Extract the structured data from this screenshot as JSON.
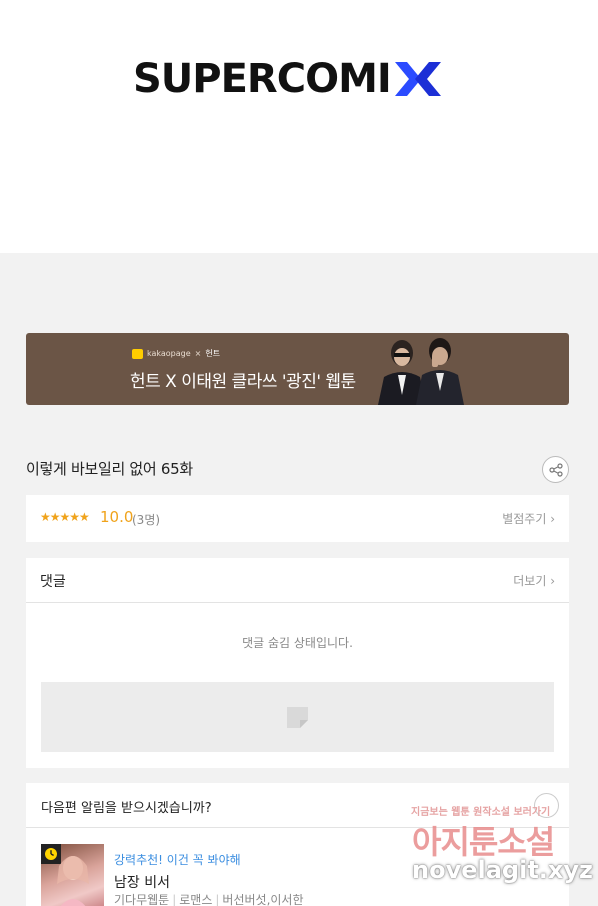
{
  "logo": {
    "text": "SUPERCOMI",
    "accent_color": "#2b4bff"
  },
  "banner": {
    "brand_left": "kakaopage",
    "brand_x": "×",
    "brand_right": "헌트",
    "text": "헌트 X 이태원 클라쓰 '광진' 웹툰",
    "bg_color": "#6b5546"
  },
  "episode": {
    "title": "이렇게 바보일리 없어 65화"
  },
  "rating": {
    "stars": "★★★★★",
    "value": "10.0",
    "count": "(3명)",
    "rate_label": "별점주기 ›",
    "color": "#f0a31b"
  },
  "comments": {
    "title": "댓글",
    "more_label": "더보기 ›",
    "hidden_notice": "댓글 숨김 상태입니다."
  },
  "notify": {
    "question": "다음편 알림을 받으시겠습니까?"
  },
  "recommend": {
    "tag": "강력추천! 이건 꼭 봐야해",
    "title": "남장 비서",
    "meta": [
      "기다무웹툰",
      "로맨스",
      "버선버섯,이서한"
    ],
    "tag_color": "#3b8ee0"
  },
  "watermark": {
    "top": "지금보는 웹툰 원작소설 보러가기",
    "main": "아지툰소설",
    "url": "novelagit.xyz"
  }
}
